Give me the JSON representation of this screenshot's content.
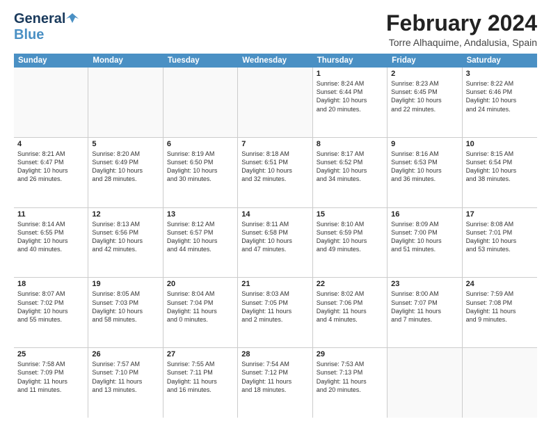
{
  "header": {
    "logo_general": "General",
    "logo_blue": "Blue",
    "month_title": "February 2024",
    "location": "Torre Alhaquime, Andalusia, Spain"
  },
  "calendar": {
    "days_of_week": [
      "Sunday",
      "Monday",
      "Tuesday",
      "Wednesday",
      "Thursday",
      "Friday",
      "Saturday"
    ],
    "weeks": [
      [
        {
          "day": "",
          "lines": []
        },
        {
          "day": "",
          "lines": []
        },
        {
          "day": "",
          "lines": []
        },
        {
          "day": "",
          "lines": []
        },
        {
          "day": "1",
          "lines": [
            "Sunrise: 8:24 AM",
            "Sunset: 6:44 PM",
            "Daylight: 10 hours",
            "and 20 minutes."
          ]
        },
        {
          "day": "2",
          "lines": [
            "Sunrise: 8:23 AM",
            "Sunset: 6:45 PM",
            "Daylight: 10 hours",
            "and 22 minutes."
          ]
        },
        {
          "day": "3",
          "lines": [
            "Sunrise: 8:22 AM",
            "Sunset: 6:46 PM",
            "Daylight: 10 hours",
            "and 24 minutes."
          ]
        }
      ],
      [
        {
          "day": "4",
          "lines": [
            "Sunrise: 8:21 AM",
            "Sunset: 6:47 PM",
            "Daylight: 10 hours",
            "and 26 minutes."
          ]
        },
        {
          "day": "5",
          "lines": [
            "Sunrise: 8:20 AM",
            "Sunset: 6:49 PM",
            "Daylight: 10 hours",
            "and 28 minutes."
          ]
        },
        {
          "day": "6",
          "lines": [
            "Sunrise: 8:19 AM",
            "Sunset: 6:50 PM",
            "Daylight: 10 hours",
            "and 30 minutes."
          ]
        },
        {
          "day": "7",
          "lines": [
            "Sunrise: 8:18 AM",
            "Sunset: 6:51 PM",
            "Daylight: 10 hours",
            "and 32 minutes."
          ]
        },
        {
          "day": "8",
          "lines": [
            "Sunrise: 8:17 AM",
            "Sunset: 6:52 PM",
            "Daylight: 10 hours",
            "and 34 minutes."
          ]
        },
        {
          "day": "9",
          "lines": [
            "Sunrise: 8:16 AM",
            "Sunset: 6:53 PM",
            "Daylight: 10 hours",
            "and 36 minutes."
          ]
        },
        {
          "day": "10",
          "lines": [
            "Sunrise: 8:15 AM",
            "Sunset: 6:54 PM",
            "Daylight: 10 hours",
            "and 38 minutes."
          ]
        }
      ],
      [
        {
          "day": "11",
          "lines": [
            "Sunrise: 8:14 AM",
            "Sunset: 6:55 PM",
            "Daylight: 10 hours",
            "and 40 minutes."
          ]
        },
        {
          "day": "12",
          "lines": [
            "Sunrise: 8:13 AM",
            "Sunset: 6:56 PM",
            "Daylight: 10 hours",
            "and 42 minutes."
          ]
        },
        {
          "day": "13",
          "lines": [
            "Sunrise: 8:12 AM",
            "Sunset: 6:57 PM",
            "Daylight: 10 hours",
            "and 44 minutes."
          ]
        },
        {
          "day": "14",
          "lines": [
            "Sunrise: 8:11 AM",
            "Sunset: 6:58 PM",
            "Daylight: 10 hours",
            "and 47 minutes."
          ]
        },
        {
          "day": "15",
          "lines": [
            "Sunrise: 8:10 AM",
            "Sunset: 6:59 PM",
            "Daylight: 10 hours",
            "and 49 minutes."
          ]
        },
        {
          "day": "16",
          "lines": [
            "Sunrise: 8:09 AM",
            "Sunset: 7:00 PM",
            "Daylight: 10 hours",
            "and 51 minutes."
          ]
        },
        {
          "day": "17",
          "lines": [
            "Sunrise: 8:08 AM",
            "Sunset: 7:01 PM",
            "Daylight: 10 hours",
            "and 53 minutes."
          ]
        }
      ],
      [
        {
          "day": "18",
          "lines": [
            "Sunrise: 8:07 AM",
            "Sunset: 7:02 PM",
            "Daylight: 10 hours",
            "and 55 minutes."
          ]
        },
        {
          "day": "19",
          "lines": [
            "Sunrise: 8:05 AM",
            "Sunset: 7:03 PM",
            "Daylight: 10 hours",
            "and 58 minutes."
          ]
        },
        {
          "day": "20",
          "lines": [
            "Sunrise: 8:04 AM",
            "Sunset: 7:04 PM",
            "Daylight: 11 hours",
            "and 0 minutes."
          ]
        },
        {
          "day": "21",
          "lines": [
            "Sunrise: 8:03 AM",
            "Sunset: 7:05 PM",
            "Daylight: 11 hours",
            "and 2 minutes."
          ]
        },
        {
          "day": "22",
          "lines": [
            "Sunrise: 8:02 AM",
            "Sunset: 7:06 PM",
            "Daylight: 11 hours",
            "and 4 minutes."
          ]
        },
        {
          "day": "23",
          "lines": [
            "Sunrise: 8:00 AM",
            "Sunset: 7:07 PM",
            "Daylight: 11 hours",
            "and 7 minutes."
          ]
        },
        {
          "day": "24",
          "lines": [
            "Sunrise: 7:59 AM",
            "Sunset: 7:08 PM",
            "Daylight: 11 hours",
            "and 9 minutes."
          ]
        }
      ],
      [
        {
          "day": "25",
          "lines": [
            "Sunrise: 7:58 AM",
            "Sunset: 7:09 PM",
            "Daylight: 11 hours",
            "and 11 minutes."
          ]
        },
        {
          "day": "26",
          "lines": [
            "Sunrise: 7:57 AM",
            "Sunset: 7:10 PM",
            "Daylight: 11 hours",
            "and 13 minutes."
          ]
        },
        {
          "day": "27",
          "lines": [
            "Sunrise: 7:55 AM",
            "Sunset: 7:11 PM",
            "Daylight: 11 hours",
            "and 16 minutes."
          ]
        },
        {
          "day": "28",
          "lines": [
            "Sunrise: 7:54 AM",
            "Sunset: 7:12 PM",
            "Daylight: 11 hours",
            "and 18 minutes."
          ]
        },
        {
          "day": "29",
          "lines": [
            "Sunrise: 7:53 AM",
            "Sunset: 7:13 PM",
            "Daylight: 11 hours",
            "and 20 minutes."
          ]
        },
        {
          "day": "",
          "lines": []
        },
        {
          "day": "",
          "lines": []
        }
      ]
    ]
  }
}
